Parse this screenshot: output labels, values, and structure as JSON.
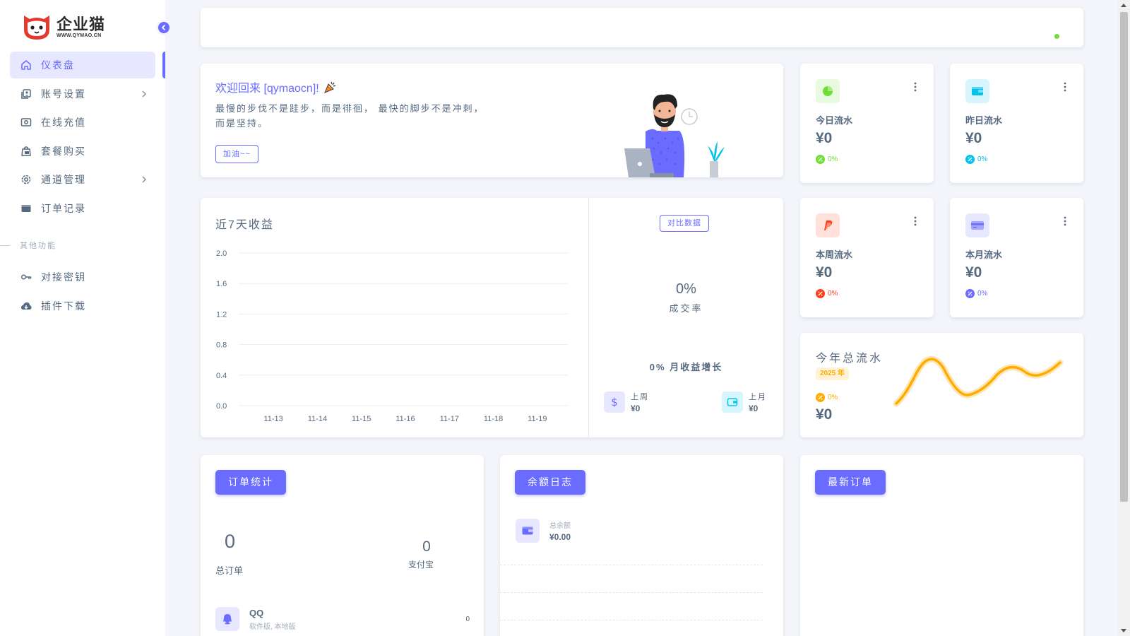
{
  "logo": {
    "main": "企业猫",
    "sub": "WWW.QYMAO.CN"
  },
  "sidebar": {
    "items": [
      {
        "label": "仪表盘",
        "icon": "home-icon",
        "active": true
      },
      {
        "label": "账号设置",
        "icon": "account-icon",
        "chevron": true
      },
      {
        "label": "在线充值",
        "icon": "recharge-icon"
      },
      {
        "label": "套餐购买",
        "icon": "package-icon"
      },
      {
        "label": "通道管理",
        "icon": "gear-icon",
        "chevron": true
      },
      {
        "label": "订单记录",
        "icon": "wallet-icon"
      }
    ],
    "section_title": "其他功能",
    "items2": [
      {
        "label": "对接密钥",
        "icon": "key-icon"
      },
      {
        "label": "插件下载",
        "icon": "cloud-download-icon"
      }
    ]
  },
  "welcome": {
    "title": "欢迎回来 [qymaocn]!",
    "text_line1": "最慢的步伐不是跬步，而是徘徊， 最快的脚步不是冲刺，",
    "text_line2": "而是坚持。",
    "button": "加油~~"
  },
  "stats": [
    {
      "label": "今日流水",
      "value": "¥0",
      "pct": "0%",
      "color": "#71dd37",
      "bg": "#e8fadf",
      "icon": "pie-chart-icon"
    },
    {
      "label": "昨日流水",
      "value": "¥0",
      "pct": "0%",
      "color": "#03c3ec",
      "bg": "#d7f5fc",
      "icon": "wallet-icon"
    },
    {
      "label": "本周流水",
      "value": "¥0",
      "pct": "0%",
      "color": "#ff3e1d",
      "bg": "#ffe0db",
      "icon": "paypal-icon"
    },
    {
      "label": "本月流水",
      "value": "¥0",
      "pct": "0%",
      "color": "#696cff",
      "bg": "#e7e7ff",
      "icon": "credit-card-icon"
    }
  ],
  "chart": {
    "title": "近7天收益",
    "compare_button": "对比数据",
    "rate_value": "0%",
    "rate_label": "成交率",
    "growth": "0% 月收益增长",
    "last_week_label": "上周",
    "last_week_value": "¥0",
    "last_month_label": "上月",
    "last_month_value": "¥0"
  },
  "chart_data": {
    "type": "bar",
    "title": "近7天收益",
    "categories": [
      "11-13",
      "11-14",
      "11-15",
      "11-16",
      "11-17",
      "11-18",
      "11-19"
    ],
    "values": [
      0,
      0,
      0,
      0,
      0,
      0,
      0
    ],
    "yticks": [
      "2.0",
      "1.6",
      "1.2",
      "0.8",
      "0.4",
      "0.0"
    ],
    "ylim": [
      0,
      2.0
    ],
    "grid": true
  },
  "year": {
    "title": "今年总流水",
    "badge": "2025 年",
    "pct": "0%",
    "value": "¥0",
    "accent": "#ffab00"
  },
  "orders": {
    "button": "订单统计",
    "total_value": "0",
    "total_label": "总订单",
    "alipay_value": "0",
    "alipay_label": "支付宝",
    "qq_name": "QQ",
    "qq_sub": "软件版, 本地版",
    "qq_count": "0"
  },
  "balance": {
    "button": "余额日志",
    "label": "总余额",
    "value": "¥0.00"
  },
  "latest": {
    "button": "最新订单"
  },
  "colors": {
    "primary": "#696cff",
    "online": "#71dd37"
  }
}
